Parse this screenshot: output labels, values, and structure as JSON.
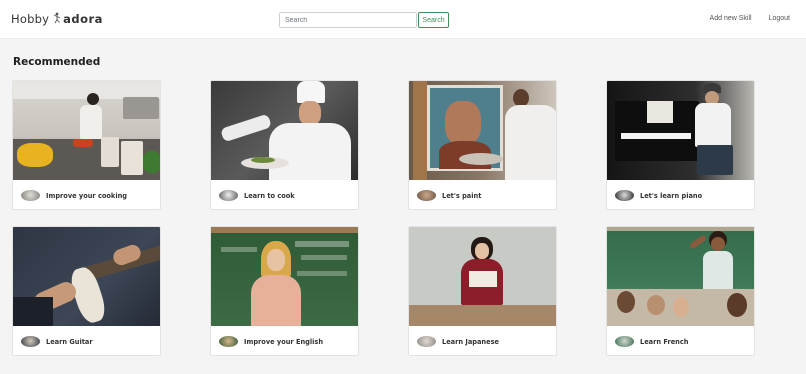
{
  "header": {
    "logo_left": "Hobby",
    "logo_right": "adora",
    "search_placeholder": "Search",
    "search_button": "Search",
    "nav": [
      "Add new Skill",
      "Logout"
    ]
  },
  "section_title": "Recommended",
  "cards": [
    {
      "title": "Improve your cooking"
    },
    {
      "title": "Learn to cook"
    },
    {
      "title": "Let's paint"
    },
    {
      "title": "Let's learn piano"
    },
    {
      "title": "Learn Guitar"
    },
    {
      "title": "Improve your English"
    },
    {
      "title": "Learn Japanese"
    },
    {
      "title": "Learn French"
    }
  ],
  "colors": {
    "accent_green": "#3f8f5a",
    "page_background": "#f4f4f4"
  }
}
